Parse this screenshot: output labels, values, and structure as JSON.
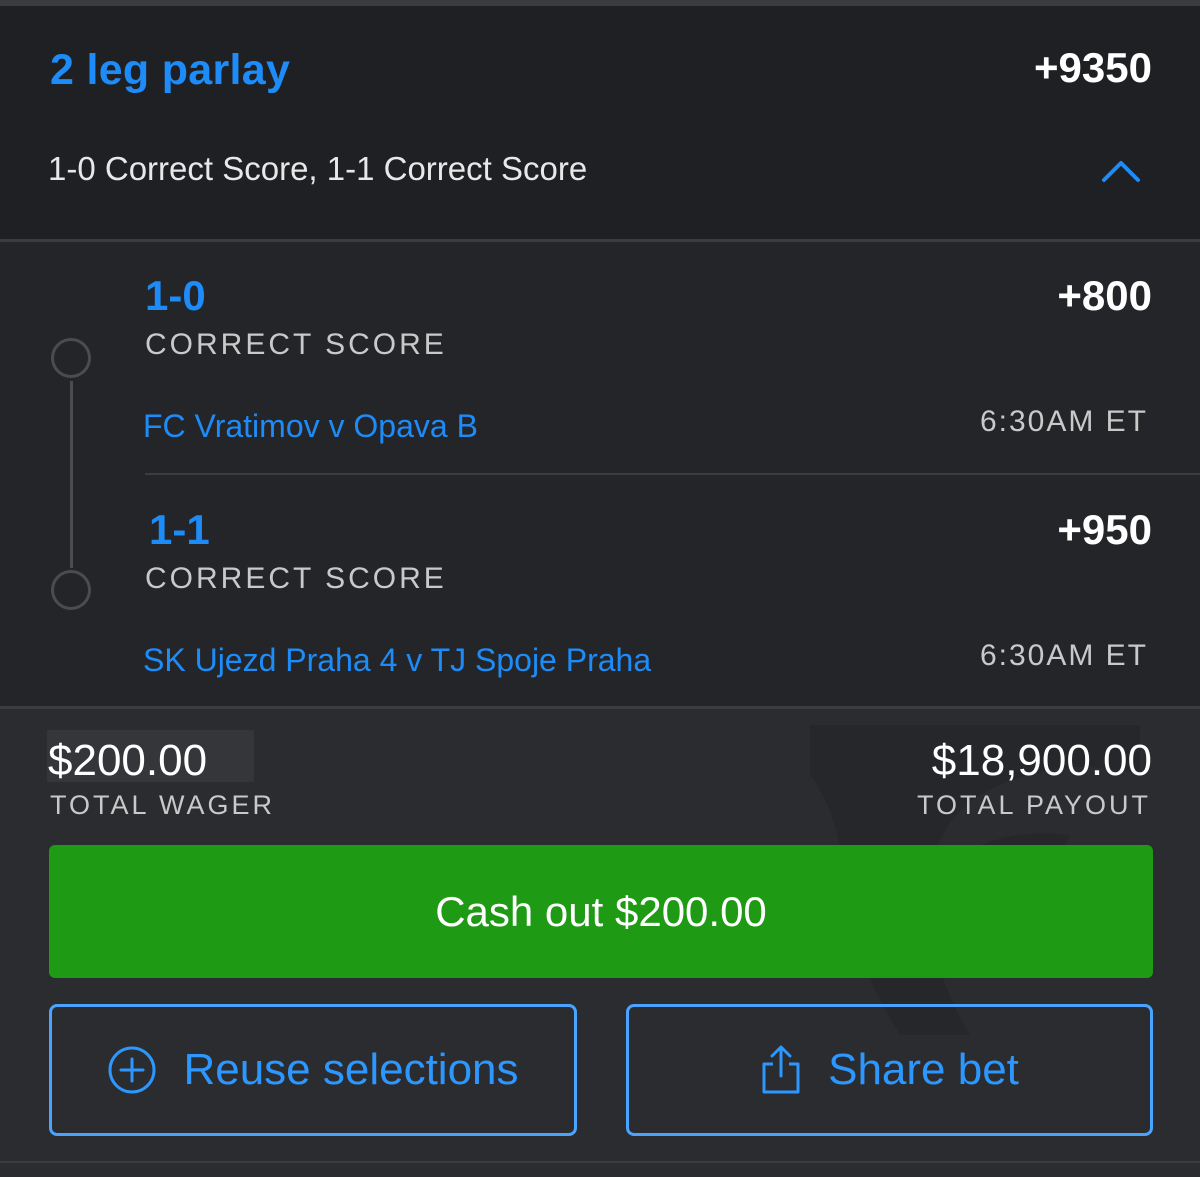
{
  "parlay": {
    "title": "2 leg parlay",
    "odds": "+9350",
    "summary": "1-0 Correct Score, 1-1 Correct Score"
  },
  "legs": [
    {
      "score": "1-0",
      "market": "CORRECT SCORE",
      "odds": "+800",
      "event": "FC Vratimov v Opava B",
      "time": "6:30AM ET"
    },
    {
      "score": "1-1",
      "market": "CORRECT SCORE",
      "odds": "+950",
      "event": "SK Ujezd Praha 4 v TJ Spoje Praha",
      "time": "6:30AM ET"
    }
  ],
  "totals": {
    "wager_amount": "$200.00",
    "wager_label": "TOTAL WAGER",
    "payout_amount": "$18,900.00",
    "payout_label": "TOTAL PAYOUT"
  },
  "actions": {
    "cashout_label": "Cash out $200.00",
    "reuse_label": "Reuse selections",
    "share_label": "Share bet"
  },
  "icons": {
    "collapse": "chevron-up-icon",
    "reuse": "plus-circle-icon",
    "share": "share-icon",
    "watermark": "shield-logo"
  },
  "colors": {
    "accent": "#1d8cf8",
    "cashout": "#1f9a14",
    "background": "#1f2023"
  }
}
